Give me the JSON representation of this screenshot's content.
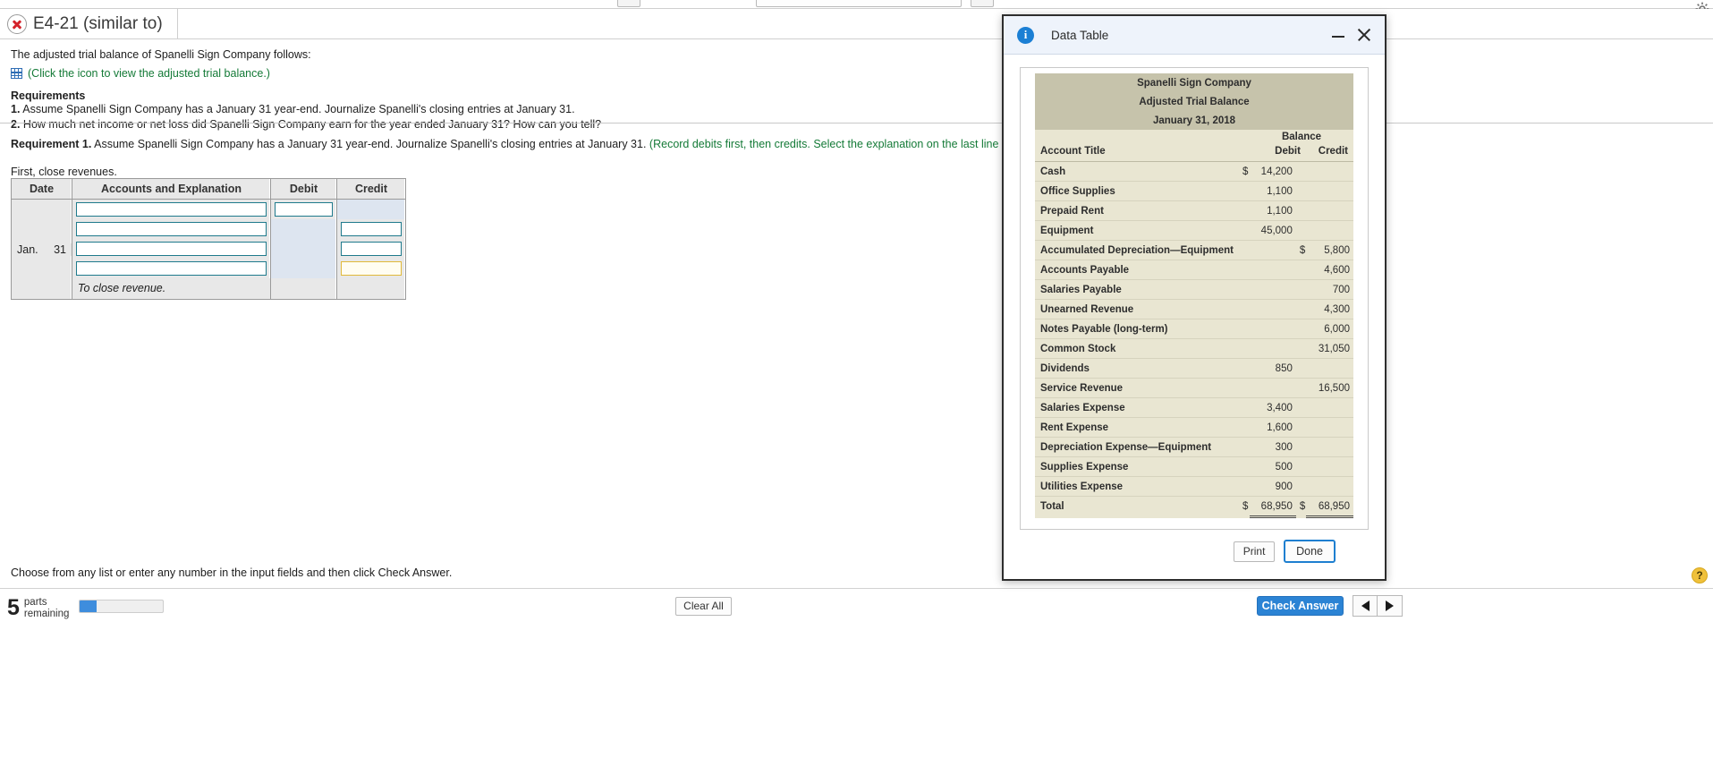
{
  "header": {
    "status_icon": "error-x-icon",
    "title": "E4-21 (similar to)"
  },
  "question": {
    "intro": "The adjusted trial balance of Spanelli Sign Company follows:",
    "icon_link": "(Click the icon to view the adjusted trial balance.)",
    "requirements_heading": "Requirements",
    "requirements": [
      {
        "num": "1.",
        "text": "Assume Spanelli Sign Company has a January 31 year-end. Journalize Spanelli's closing entries at January 31."
      },
      {
        "num": "2.",
        "text": "How much net income or net loss did Spanelli Sign Company earn for the year ended January 31? How can you tell?"
      }
    ]
  },
  "requirement1": {
    "label": "Requirement 1.",
    "text": "Assume Spanelli Sign Company has a January 31 year-end. Journalize Spanelli's closing entries at January 31.",
    "hint": "(Record debits first, then credits. Select the explanation on the last line of the journal entry table.)",
    "subtitle": "First, close revenues."
  },
  "journal": {
    "columns": [
      "Date",
      "Accounts and Explanation",
      "Debit",
      "Credit"
    ],
    "date_month": "Jan.",
    "date_day": "31",
    "rows": [
      {
        "account": "",
        "debit": "",
        "credit": "",
        "account_state": "empty",
        "debit_state": "input",
        "credit_state": "disabled"
      },
      {
        "account": "",
        "debit": "",
        "credit": "",
        "account_state": "empty",
        "debit_state": "disabled",
        "credit_state": "input"
      },
      {
        "account": "",
        "debit": "",
        "credit": "",
        "account_state": "empty",
        "debit_state": "disabled",
        "credit_state": "input"
      },
      {
        "account": "",
        "debit": "",
        "credit": "",
        "account_state": "empty",
        "debit_state": "disabled",
        "credit_state": "focused"
      }
    ],
    "explanation": "To close revenue."
  },
  "prompt": "Choose from any list or enter any number in the input fields and then click Check Answer.",
  "footer": {
    "parts_count": "5",
    "parts_label_line1": "parts",
    "parts_label_line2": "remaining",
    "progress_percent": 20,
    "clear_all": "Clear All",
    "check_answer": "Check Answer",
    "prev_icon": "left-arrow-icon",
    "next_icon": "right-arrow-icon",
    "help_badge": "?"
  },
  "dialog": {
    "icon": "info-icon",
    "title": "Data Table",
    "minimize_icon": "minimize-icon",
    "close_icon": "close-icon",
    "print_label": "Print",
    "done_label": "Done"
  },
  "chart_data": {
    "type": "table",
    "title": "Spanelli Sign Company",
    "subtitle": "Adjusted Trial Balance",
    "date": "January 31, 2018",
    "group_header": "Balance",
    "columns": [
      "Account Title",
      "Debit",
      "Credit"
    ],
    "currency_symbol": "$",
    "rows": [
      {
        "account": "Cash",
        "debit": "14,200",
        "credit": "",
        "debit_cur": "$",
        "credit_cur": ""
      },
      {
        "account": "Office Supplies",
        "debit": "1,100",
        "credit": "",
        "debit_cur": "",
        "credit_cur": ""
      },
      {
        "account": "Prepaid Rent",
        "debit": "1,100",
        "credit": "",
        "debit_cur": "",
        "credit_cur": ""
      },
      {
        "account": "Equipment",
        "debit": "45,000",
        "credit": "",
        "debit_cur": "",
        "credit_cur": ""
      },
      {
        "account": "Accumulated Depreciation—Equipment",
        "debit": "",
        "credit": "5,800",
        "debit_cur": "",
        "credit_cur": "$"
      },
      {
        "account": "Accounts Payable",
        "debit": "",
        "credit": "4,600",
        "debit_cur": "",
        "credit_cur": ""
      },
      {
        "account": "Salaries Payable",
        "debit": "",
        "credit": "700",
        "debit_cur": "",
        "credit_cur": ""
      },
      {
        "account": "Unearned Revenue",
        "debit": "",
        "credit": "4,300",
        "debit_cur": "",
        "credit_cur": ""
      },
      {
        "account": "Notes Payable (long-term)",
        "debit": "",
        "credit": "6,000",
        "debit_cur": "",
        "credit_cur": ""
      },
      {
        "account": "Common Stock",
        "debit": "",
        "credit": "31,050",
        "debit_cur": "",
        "credit_cur": ""
      },
      {
        "account": "Dividends",
        "debit": "850",
        "credit": "",
        "debit_cur": "",
        "credit_cur": ""
      },
      {
        "account": "Service Revenue",
        "debit": "",
        "credit": "16,500",
        "debit_cur": "",
        "credit_cur": ""
      },
      {
        "account": "Salaries Expense",
        "debit": "3,400",
        "credit": "",
        "debit_cur": "",
        "credit_cur": ""
      },
      {
        "account": "Rent Expense",
        "debit": "1,600",
        "credit": "",
        "debit_cur": "",
        "credit_cur": ""
      },
      {
        "account": "Depreciation Expense—Equipment",
        "debit": "300",
        "credit": "",
        "debit_cur": "",
        "credit_cur": ""
      },
      {
        "account": "Supplies Expense",
        "debit": "500",
        "credit": "",
        "debit_cur": "",
        "credit_cur": ""
      },
      {
        "account": "Utilities Expense",
        "debit": "900",
        "credit": "",
        "debit_cur": "",
        "credit_cur": ""
      }
    ],
    "total": {
      "account": "Total",
      "debit": "68,950",
      "credit": "68,950",
      "debit_cur": "$",
      "credit_cur": "$"
    }
  }
}
